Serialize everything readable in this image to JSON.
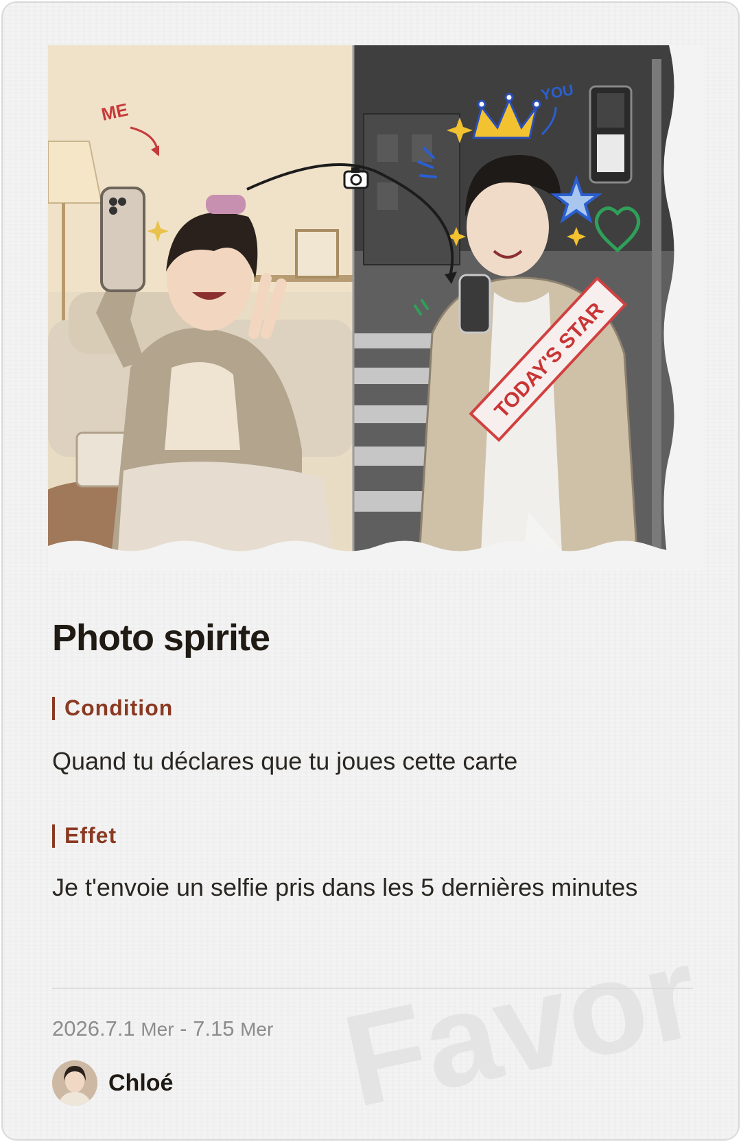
{
  "card": {
    "title": "Photo spirite",
    "illustration": {
      "label_me": "ME",
      "label_you": "YOU",
      "sash_text": "TODAY'S STAR"
    },
    "condition": {
      "label": "Condition",
      "text": "Quand tu déclares que tu joues cette carte"
    },
    "effect": {
      "label": "Effet",
      "text": "Je t'envoie un selfie pris dans les 5 dernières minutes"
    },
    "dates": {
      "start": "2026.7.1",
      "start_day": "Mer",
      "separator": " - ",
      "end": "7.15",
      "end_day": "Mer"
    },
    "author": {
      "name": "Chloé"
    },
    "watermark": "Favor"
  },
  "colors": {
    "accent": "#8a3a22",
    "title": "#1f1a14",
    "body_text": "#2a2622",
    "muted": "#8c8c8c",
    "card_bg": "#f3f3f3"
  },
  "icons": [
    "camera-icon",
    "crown-icon",
    "star-icon",
    "heart-icon",
    "sparkle-icon"
  ]
}
